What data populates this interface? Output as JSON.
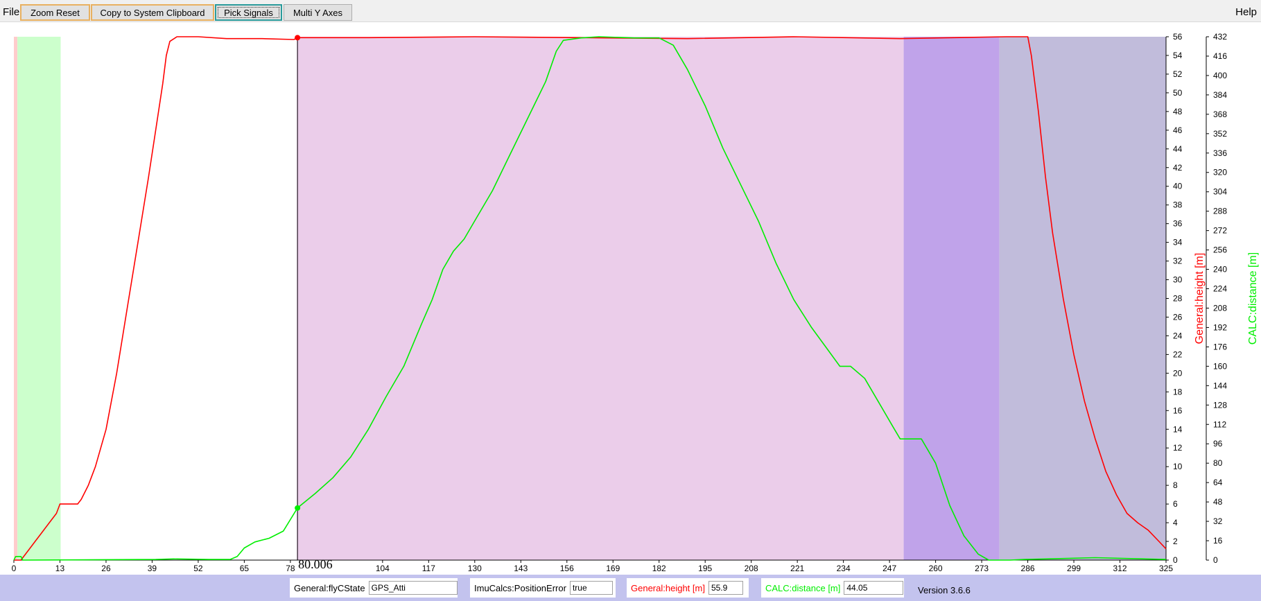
{
  "menu": {
    "file_label": "File",
    "help_label": "Help"
  },
  "toolbar": {
    "zoom_reset_label": "Zoom Reset",
    "copy_label": "Copy to System Clipboard",
    "pick_signals_label": "Pick Signals",
    "multi_y_label": "Multi Y Axes"
  },
  "colors": {
    "height_series": "#ff0000",
    "distance_series": "#00ee00",
    "region_pink": "#ffcccc",
    "region_green": "#ccffcc",
    "region_orchid": "#ebcdea",
    "region_violet": "#c0a3ea",
    "region_slate": "#c1bcdb",
    "statusbar_bg": "#c3c3ee"
  },
  "cursor": {
    "time": 80.006,
    "time_label": "80.006"
  },
  "status": {
    "flyc_label": "General:flyCState",
    "flyc_value": "GPS_Atti",
    "poserr_label": "ImuCalcs:PositionError",
    "poserr_value": "true",
    "height_label": "General:height [m]",
    "height_value": "55.9",
    "distance_label": "CALC:distance [m]",
    "distance_value": "44.05",
    "version": "Version 3.6.6"
  },
  "chart_data": {
    "type": "line",
    "x_ticks": [
      0,
      13,
      26,
      39,
      52,
      65,
      78,
      104,
      117,
      130,
      143,
      156,
      169,
      182,
      195,
      208,
      221,
      234,
      247,
      260,
      273,
      286,
      299,
      312,
      325
    ],
    "xlim": [
      0,
      325
    ],
    "y_left": {
      "label": "General:height [m]",
      "ylim": [
        0,
        56
      ],
      "ticks": [
        0,
        2,
        4,
        6,
        8,
        10,
        12,
        14,
        16,
        18,
        20,
        22,
        24,
        26,
        28,
        30,
        32,
        34,
        36,
        38,
        40,
        42,
        44,
        46,
        48,
        50,
        52,
        54,
        56
      ]
    },
    "y_right": {
      "label": "CALC:distance [m]",
      "ylim": [
        0,
        432
      ],
      "ticks": [
        0,
        16,
        32,
        48,
        64,
        80,
        96,
        112,
        128,
        144,
        160,
        176,
        192,
        208,
        224,
        240,
        256,
        272,
        288,
        304,
        320,
        336,
        352,
        368,
        384,
        400,
        416,
        432
      ]
    },
    "regions": [
      {
        "from": 0,
        "to": 1,
        "color": "#ffcccc"
      },
      {
        "from": 1,
        "to": 13.2,
        "color": "#ccffcc"
      },
      {
        "from": 79.8,
        "to": 251,
        "color": "#ebcdea"
      },
      {
        "from": 251,
        "to": 278,
        "color": "#c0a3ea"
      },
      {
        "from": 278,
        "to": 325,
        "color": "#c1bcdb"
      }
    ],
    "series": [
      {
        "name": "General:height [m]",
        "axis": "left",
        "color": "#ff0000",
        "points": [
          [
            0,
            0
          ],
          [
            2,
            0
          ],
          [
            4,
            1
          ],
          [
            6,
            2
          ],
          [
            8,
            3
          ],
          [
            10,
            4
          ],
          [
            12,
            5
          ],
          [
            13,
            6
          ],
          [
            15,
            6
          ],
          [
            18,
            6
          ],
          [
            19,
            6.5
          ],
          [
            21,
            8
          ],
          [
            23,
            10
          ],
          [
            26,
            14
          ],
          [
            29,
            20
          ],
          [
            32,
            27
          ],
          [
            35,
            34
          ],
          [
            38,
            41
          ],
          [
            40,
            46
          ],
          [
            42,
            51
          ],
          [
            43,
            54
          ],
          [
            44,
            55.5
          ],
          [
            46,
            56
          ],
          [
            52,
            56
          ],
          [
            60,
            55.8
          ],
          [
            70,
            55.8
          ],
          [
            79,
            55.7
          ],
          [
            80,
            55.9
          ],
          [
            100,
            55.9
          ],
          [
            130,
            56
          ],
          [
            160,
            55.9
          ],
          [
            190,
            55.8
          ],
          [
            220,
            56
          ],
          [
            250,
            55.8
          ],
          [
            280,
            56
          ],
          [
            284,
            56
          ],
          [
            286,
            56
          ],
          [
            287,
            54
          ],
          [
            289,
            48
          ],
          [
            291,
            41
          ],
          [
            293,
            35
          ],
          [
            296,
            28
          ],
          [
            299,
            22
          ],
          [
            302,
            17
          ],
          [
            305,
            13
          ],
          [
            308,
            9.5
          ],
          [
            311,
            7
          ],
          [
            314,
            5
          ],
          [
            317,
            4
          ],
          [
            320,
            3.2
          ],
          [
            323,
            2
          ],
          [
            325,
            1.2
          ]
        ]
      },
      {
        "name": "CALC:distance [m]",
        "axis": "right",
        "color": "#00ee00",
        "points": [
          [
            0,
            0
          ],
          [
            0.5,
            3
          ],
          [
            2,
            3
          ],
          [
            2.5,
            0
          ],
          [
            40,
            0.5
          ],
          [
            45,
            1
          ],
          [
            55,
            0.5
          ],
          [
            61,
            0.5
          ],
          [
            63,
            3
          ],
          [
            65,
            10
          ],
          [
            68,
            15
          ],
          [
            72,
            18
          ],
          [
            76,
            24
          ],
          [
            80,
            43
          ],
          [
            85,
            55
          ],
          [
            90,
            68
          ],
          [
            95,
            85
          ],
          [
            100,
            108
          ],
          [
            105,
            135
          ],
          [
            110,
            160
          ],
          [
            115,
            195
          ],
          [
            118,
            215
          ],
          [
            121,
            240
          ],
          [
            124,
            255
          ],
          [
            127,
            265
          ],
          [
            130,
            280
          ],
          [
            135,
            305
          ],
          [
            140,
            335
          ],
          [
            145,
            365
          ],
          [
            150,
            395
          ],
          [
            153,
            420
          ],
          [
            155,
            429
          ],
          [
            160,
            431
          ],
          [
            165,
            432
          ],
          [
            175,
            431
          ],
          [
            182,
            431
          ],
          [
            186,
            425
          ],
          [
            190,
            405
          ],
          [
            195,
            375
          ],
          [
            200,
            340
          ],
          [
            205,
            310
          ],
          [
            210,
            280
          ],
          [
            215,
            245
          ],
          [
            220,
            215
          ],
          [
            225,
            192
          ],
          [
            230,
            172
          ],
          [
            233,
            160
          ],
          [
            236,
            160
          ],
          [
            240,
            150
          ],
          [
            244,
            130
          ],
          [
            248,
            110
          ],
          [
            250,
            100
          ],
          [
            256,
            100
          ],
          [
            260,
            80
          ],
          [
            264,
            45
          ],
          [
            268,
            20
          ],
          [
            272,
            5
          ],
          [
            275,
            0
          ],
          [
            281,
            0
          ],
          [
            285,
            0.5
          ],
          [
            305,
            2
          ],
          [
            325,
            0.5
          ]
        ]
      }
    ]
  }
}
